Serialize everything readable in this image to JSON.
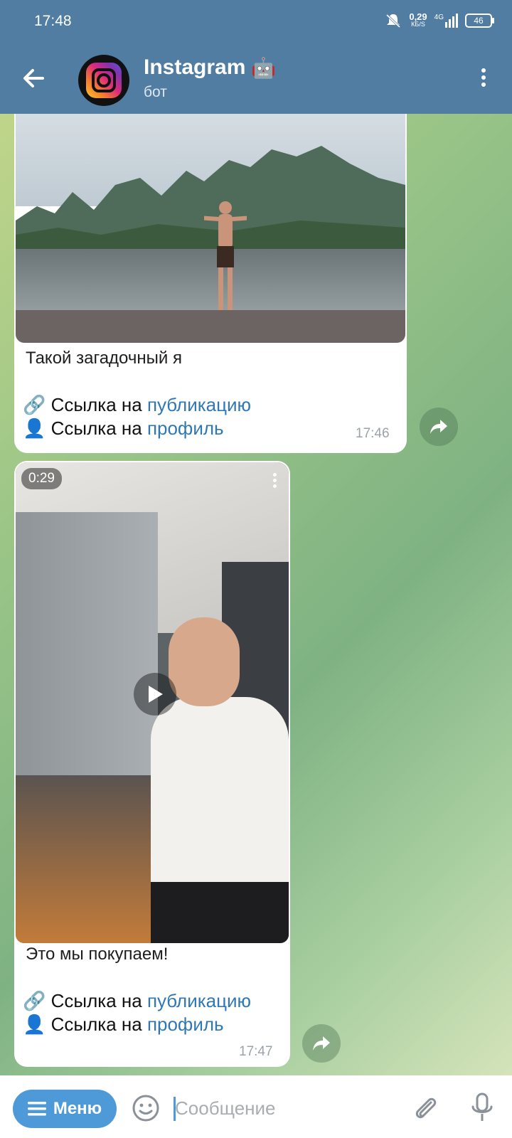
{
  "status_bar": {
    "time": "17:48",
    "speed": "0,29",
    "speed_unit": "КБ/S",
    "network": "4G",
    "battery": "46"
  },
  "header": {
    "title": "Instagram",
    "title_emoji": "🤖",
    "subtitle": "бот"
  },
  "messages": [
    {
      "caption": "Такой загадочный я",
      "link_line_1_text": "Ссылка на",
      "link_line_1_link": "публикацию",
      "link_line_2_text": "Ссылка на",
      "link_line_2_link": "профиль",
      "link_icon_1": "🔗",
      "link_icon_2": "👤",
      "time": "17:46"
    },
    {
      "duration": "0:29",
      "caption": "Это мы покупаем!",
      "link_line_1_text": "Ссылка на",
      "link_line_1_link": "публикацию",
      "link_line_2_text": "Ссылка на",
      "link_line_2_link": "профиль",
      "link_icon_1": "🔗",
      "link_icon_2": "👤",
      "time": "17:47"
    }
  ],
  "bottom_bar": {
    "menu_label": "Меню",
    "input_placeholder": "Сообщение"
  },
  "colors": {
    "header": "#527da3",
    "accent": "#4e9ad8",
    "link": "#2f78b5"
  }
}
